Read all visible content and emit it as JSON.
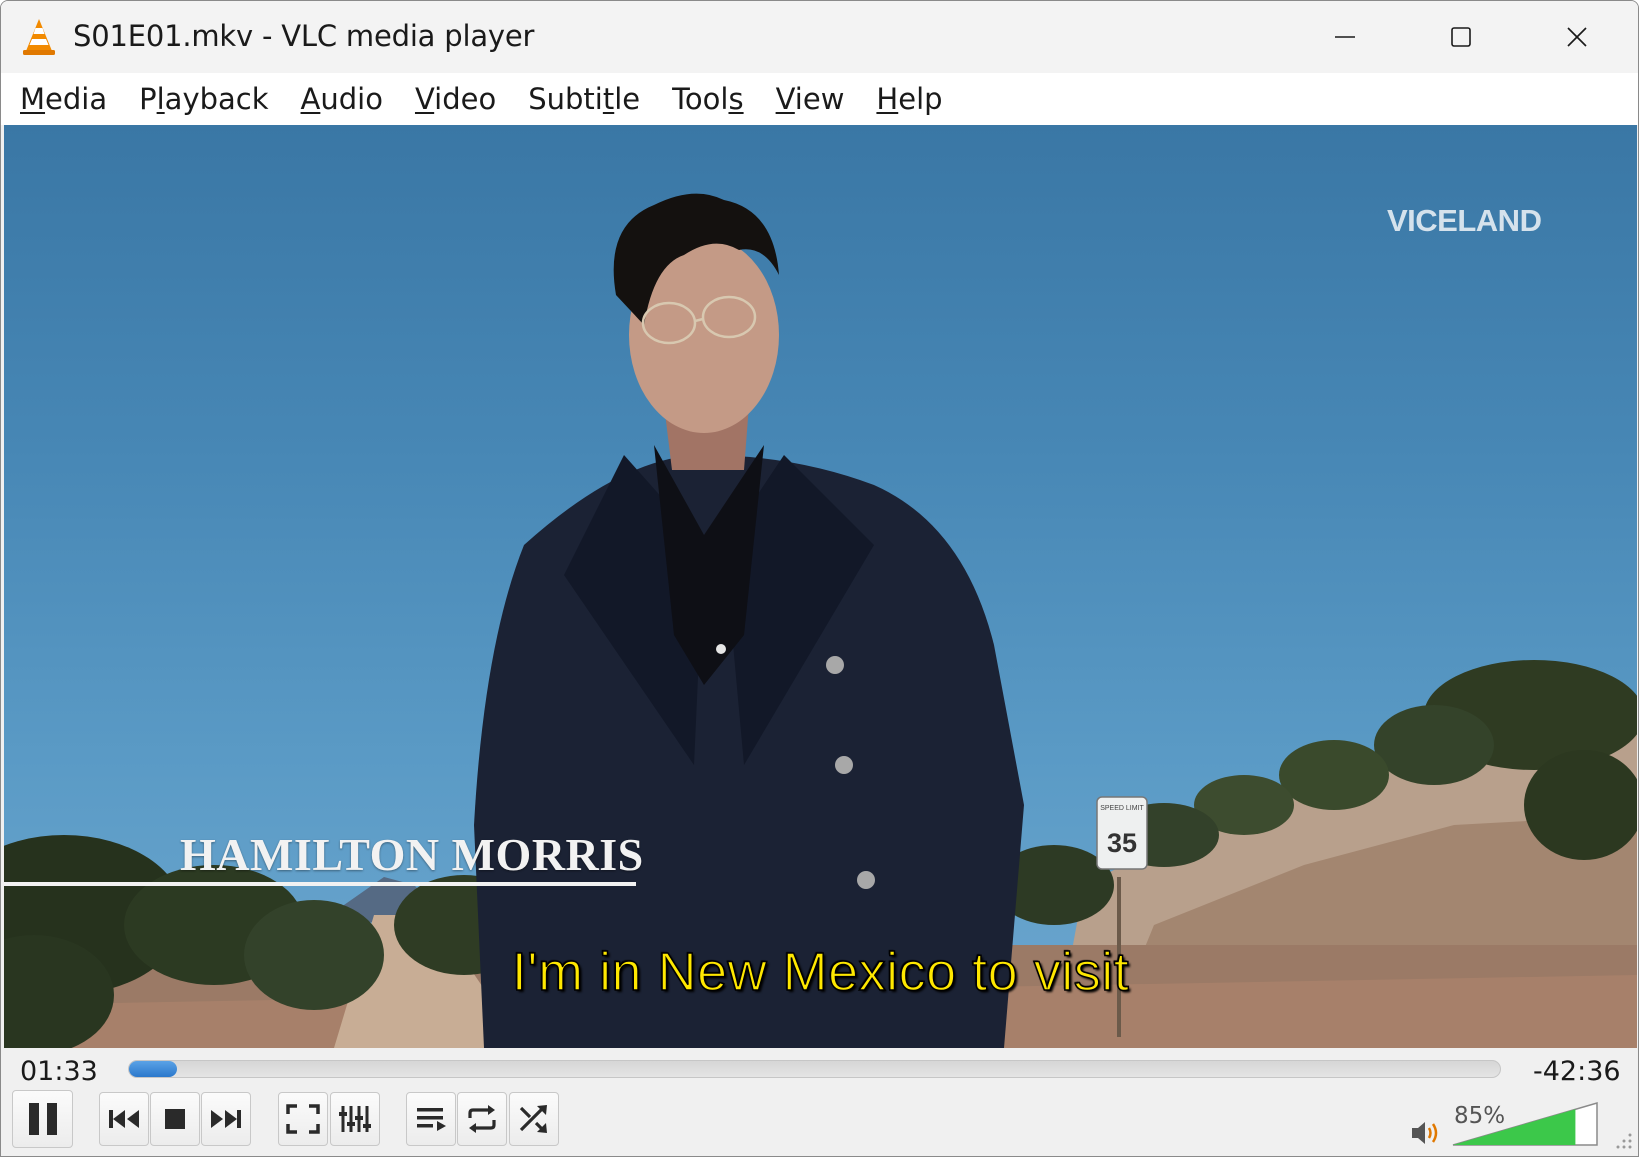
{
  "window": {
    "title": "S01E01.mkv - VLC media player"
  },
  "menu": [
    {
      "pre": "",
      "u": "M",
      "post": "edia"
    },
    {
      "pre": "P",
      "u": "l",
      "post": "ayback"
    },
    {
      "pre": "",
      "u": "A",
      "post": "udio"
    },
    {
      "pre": "",
      "u": "V",
      "post": "ideo"
    },
    {
      "pre": "Subti",
      "u": "t",
      "post": "le"
    },
    {
      "pre": "Tool",
      "u": "s",
      "post": ""
    },
    {
      "pre": "",
      "u": "V",
      "post": "iew"
    },
    {
      "pre": "",
      "u": "H",
      "post": "elp"
    }
  ],
  "video": {
    "watermark": "VICELAND",
    "lower_third": "HAMILTON MORRIS",
    "subtitle": "I'm in New Mexico to visit",
    "sign_top": "SPEED LIMIT",
    "sign_number": "35"
  },
  "playback": {
    "elapsed": "01:33",
    "remaining": "-42:36",
    "progress_fraction": 0.035
  },
  "controls": {
    "buttons": [
      "pause-icon",
      "previous-icon",
      "stop-icon",
      "next-icon",
      "fullscreen-icon",
      "extended-settings-icon",
      "playlist-icon",
      "loop-icon",
      "shuffle-icon"
    ]
  },
  "volume": {
    "label": "85%",
    "level": 0.85
  },
  "colors": {
    "seek_fill": "#2a78cc",
    "volume_fill": "#3cc84a",
    "subtitle": "#ffe800"
  }
}
